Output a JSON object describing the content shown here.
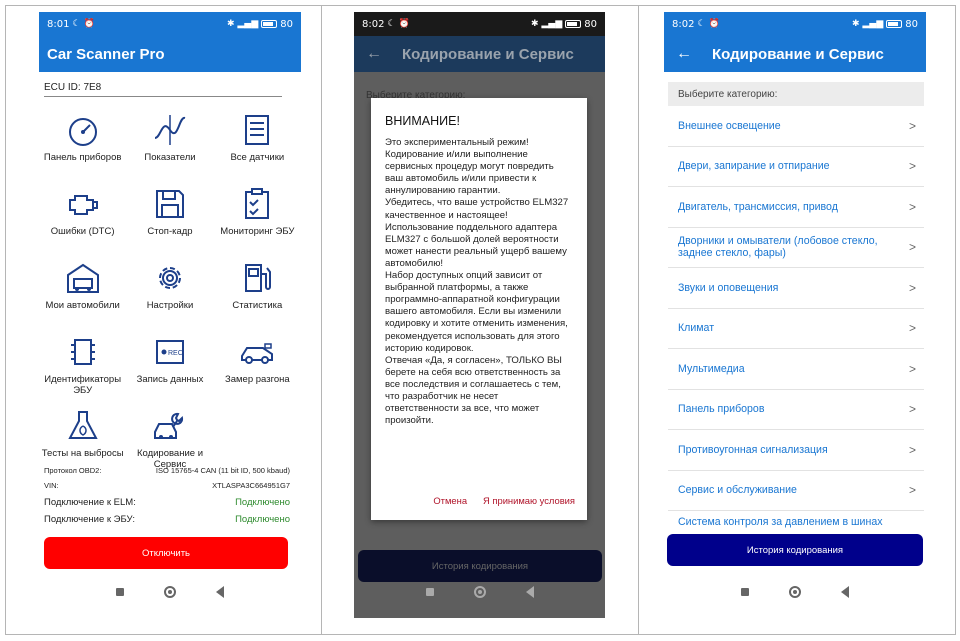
{
  "status_bar": {
    "time": "8:01",
    "time2": "8:02",
    "battery": "80"
  },
  "screen1": {
    "title": "Car Scanner Pro",
    "ecu_id": "ECU ID: 7E8",
    "tiles": [
      {
        "label": "Панель приборов",
        "icon": "gauge-icon"
      },
      {
        "label": "Показатели",
        "icon": "sine-wave-icon"
      },
      {
        "label": "Все датчики",
        "icon": "list-icon"
      },
      {
        "label": "Ошибки (DTC)",
        "icon": "engine-icon"
      },
      {
        "label": "Стоп-кадр",
        "icon": "floppy-disk-icon"
      },
      {
        "label": "Мониторинг ЭБУ",
        "icon": "clipboard-check-icon"
      },
      {
        "label": "Мои автомобили",
        "icon": "garage-icon"
      },
      {
        "label": "Настройки",
        "icon": "gear-icon"
      },
      {
        "label": "Статистика",
        "icon": "fuel-pump-icon"
      },
      {
        "label": "Идентификаторы ЭБУ",
        "icon": "chip-icon"
      },
      {
        "label": "Запись данных",
        "icon": "record-icon"
      },
      {
        "label": "Замер разгона",
        "icon": "race-car-icon"
      },
      {
        "label": "Тесты на выбросы",
        "icon": "flask-icon"
      },
      {
        "label": "Кодирование и Сервис",
        "icon": "car-wrench-icon"
      }
    ],
    "protocol_label": "Протокол OBD2:",
    "protocol_value": "ISO 15765-4 CAN (11 bit ID, 500 kbaud)",
    "vin_label": "VIN:",
    "vin_value": "XTLASPA3C664951G7",
    "elm_label": "Подключение к ELM:",
    "elm_value": "Подключено",
    "ecu_label": "Подключение к ЭБУ:",
    "ecu_value": "Подключено",
    "disconnect_label": "Отключить"
  },
  "screen2": {
    "title": "Кодирование и Сервис",
    "bg_text": "Выберите категорию:",
    "dialog_title": "ВНИМАНИЕ!",
    "dialog_body": "Это экспериментальный режим!\nКодирование и/или выполнение сервисных процедур могут повредить ваш автомобиль и/или привести к аннулированию гарантии.\nУбедитесь, что ваше устройство ELM327 качественное и настоящее! Использование поддельного адаптера ELM327 с большой долей вероятности может нанести реальный ущерб вашему автомобилю!\nНабор доступных опций зависит от выбранной платформы, а также программно-аппаратной конфигурации вашего автомобиля. Если вы изменили кодировку и хотите отменить изменения, рекомендуется использовать для этого историю кодировок.\nОтвечая «Да, я согласен», ТОЛЬКО ВЫ берете на себя всю ответственность за все последствия и соглашаетесь с тем, что разработчик не несет ответственности за все, что может произойти.",
    "cancel_label": "Отмена",
    "accept_label": "Я принимаю условия",
    "history_label": "История кодирования"
  },
  "screen3": {
    "title": "Кодирование и Сервис",
    "header": "Выберите категорию:",
    "categories": [
      "Внешнее освещение",
      "Двери, запирание и отпирание",
      "Двигатель, трансмиссия, привод",
      "Дворники и омыватели (лобовое стекло, заднее стекло, фары)",
      "Звуки и оповещения",
      "Климат",
      "Мультимедиа",
      "Панель приборов",
      "Противоугонная сигнализация",
      "Сервис и обслуживание"
    ],
    "cut_category": "Система контроля за давлением в шинах",
    "arrow": ">",
    "history_label": "История кодирования"
  }
}
